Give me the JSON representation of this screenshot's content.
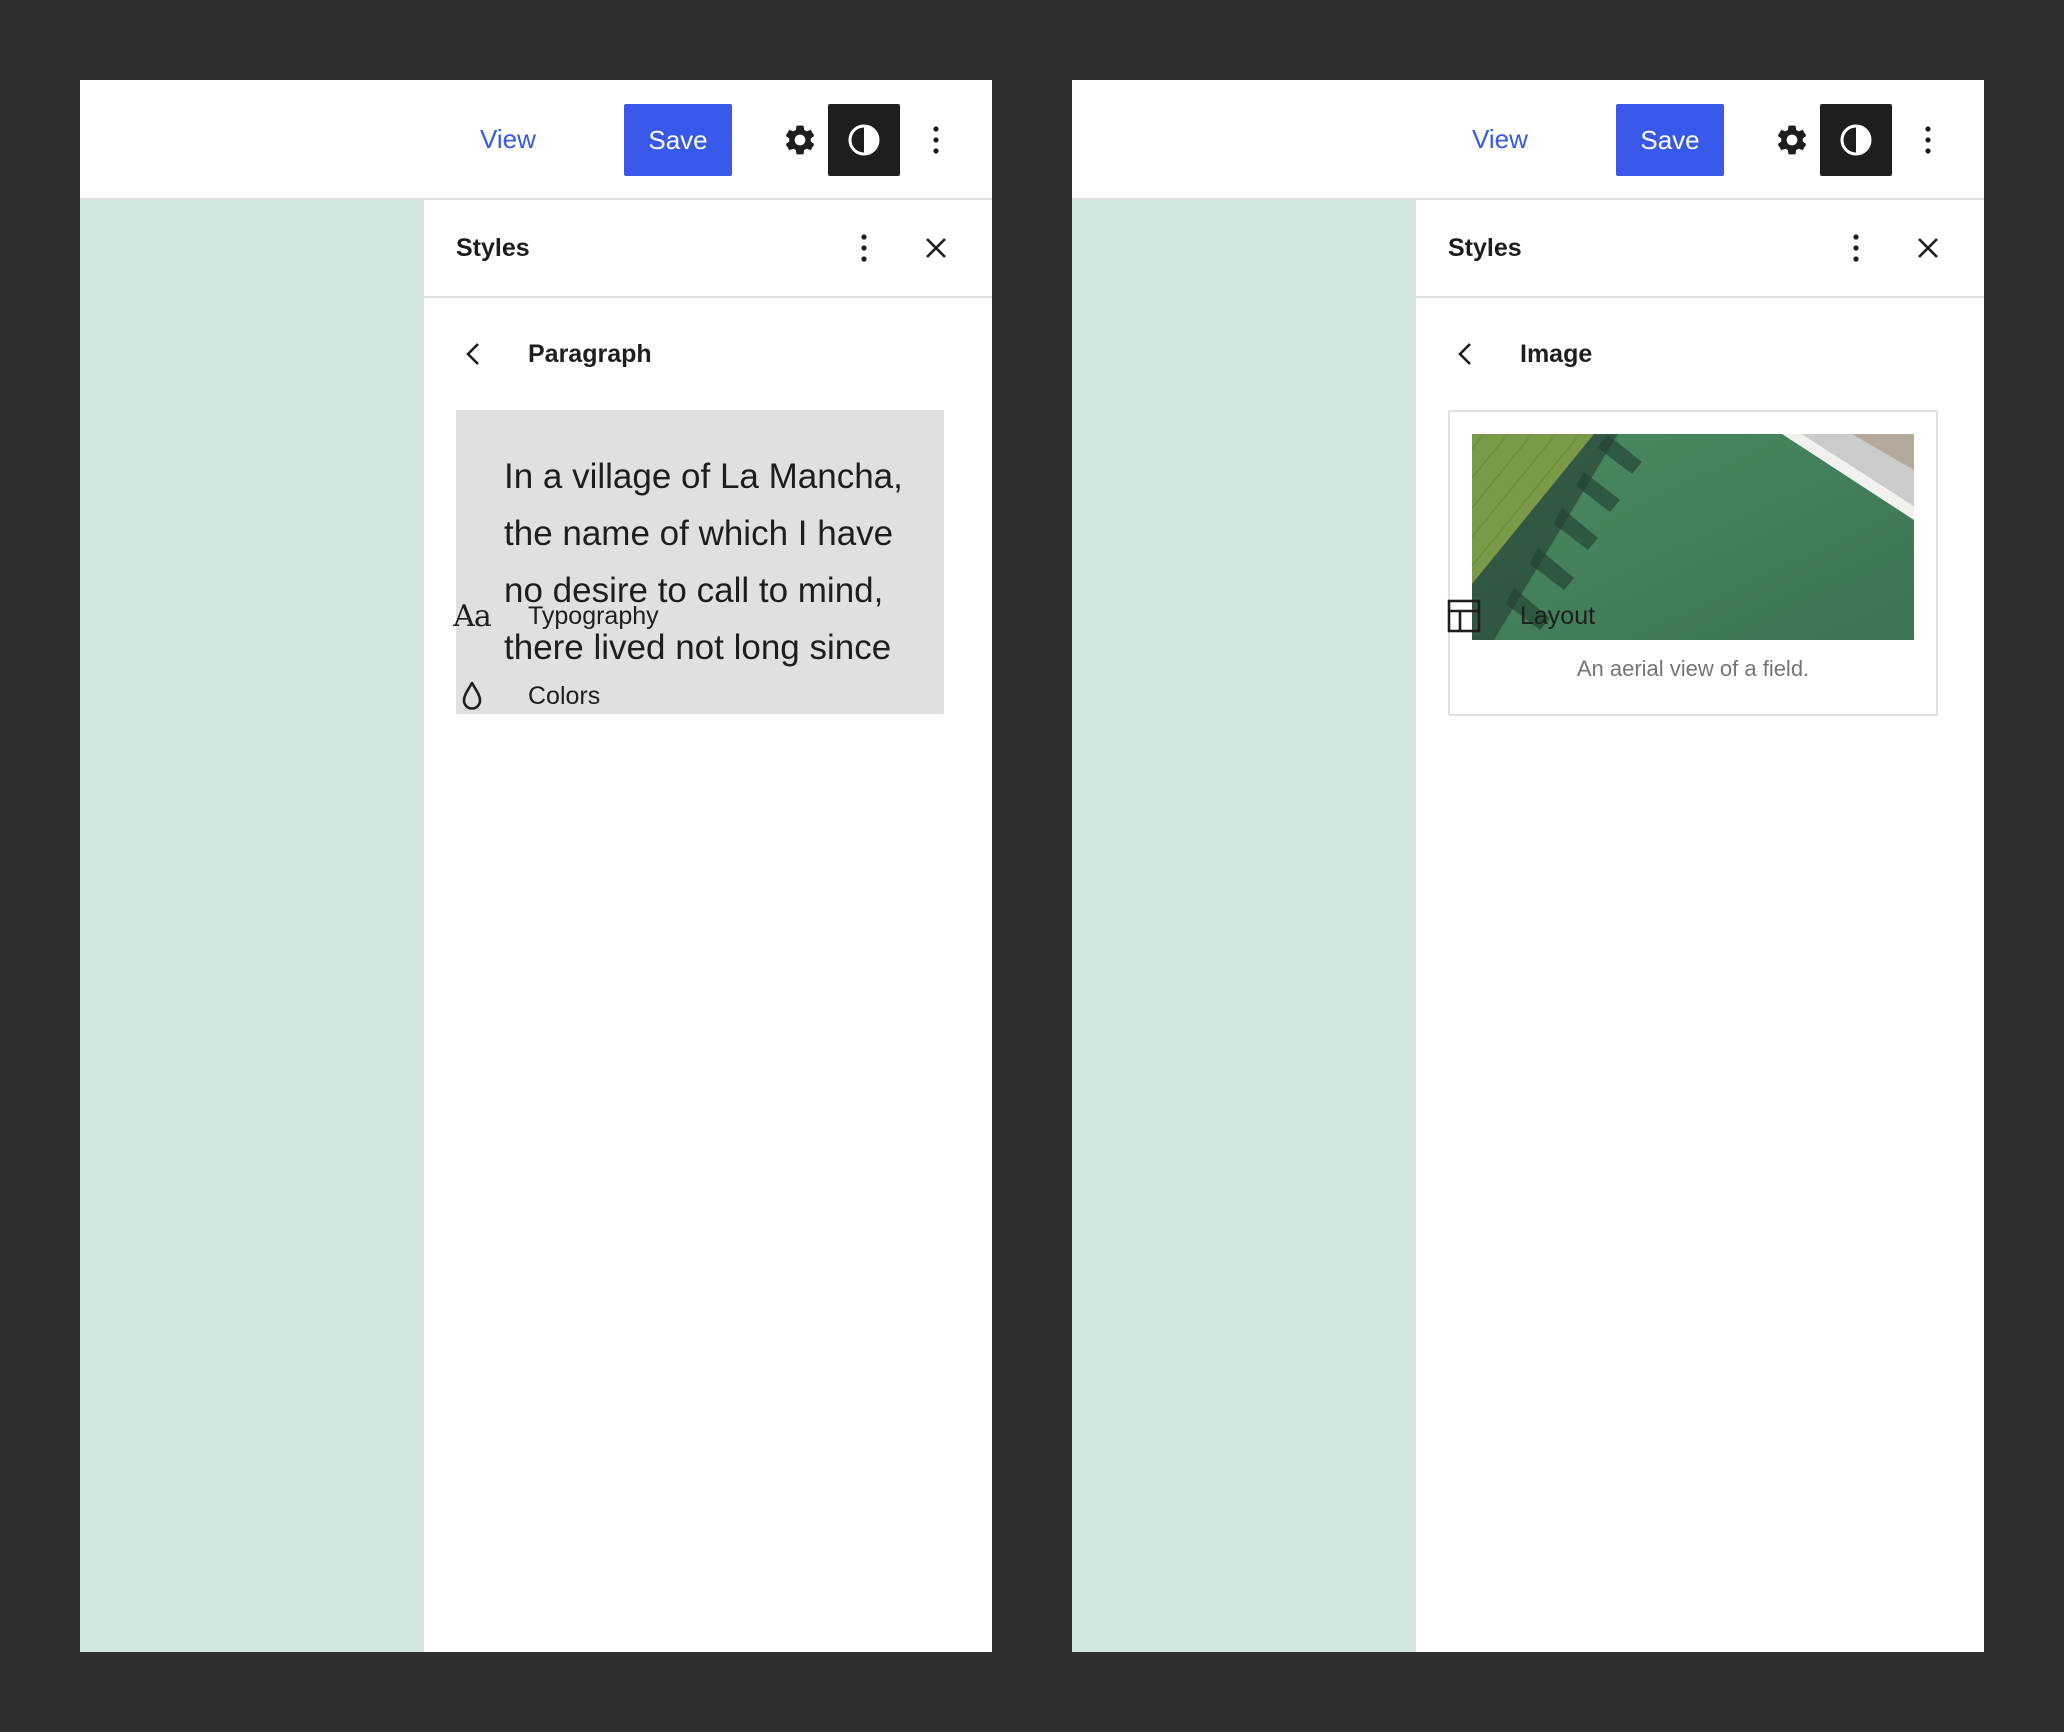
{
  "colors": {
    "backdrop": "#2f2f2f",
    "accent": "#3858e9",
    "canvas": "#d2e5de",
    "toggle_dark": "#1e1e1e",
    "preview_gray": "#e0e0e0"
  },
  "left_panel": {
    "toolbar": {
      "view_label": "View",
      "save_label": "Save",
      "icons": [
        "gear-icon",
        "half-circle-contrast-icon",
        "vertical-ellipsis-icon"
      ]
    },
    "sidebar": {
      "title": "Styles",
      "icons": [
        "vertical-ellipsis-icon",
        "close-icon"
      ],
      "nav": {
        "back_icon": "chevron-left-icon",
        "title": "Paragraph"
      },
      "preview_text": "In a village of La Mancha, the name of which I have no desire to call to mind, there lived not long since",
      "items": [
        {
          "icon": "typography-aa-icon",
          "icon_text": "Aa",
          "label": "Typography"
        },
        {
          "icon": "droplet-icon",
          "label": "Colors"
        }
      ]
    }
  },
  "right_panel": {
    "toolbar": {
      "view_label": "View",
      "save_label": "Save",
      "icons": [
        "gear-icon",
        "half-circle-contrast-icon",
        "vertical-ellipsis-icon"
      ]
    },
    "sidebar": {
      "title": "Styles",
      "icons": [
        "vertical-ellipsis-icon",
        "close-icon"
      ],
      "nav": {
        "back_icon": "chevron-left-icon",
        "title": "Image"
      },
      "preview_image": {
        "subject": "aerial-field-photo",
        "caption": "An aerial view of a field."
      },
      "items": [
        {
          "icon": "layout-icon",
          "label": "Layout"
        }
      ]
    }
  }
}
